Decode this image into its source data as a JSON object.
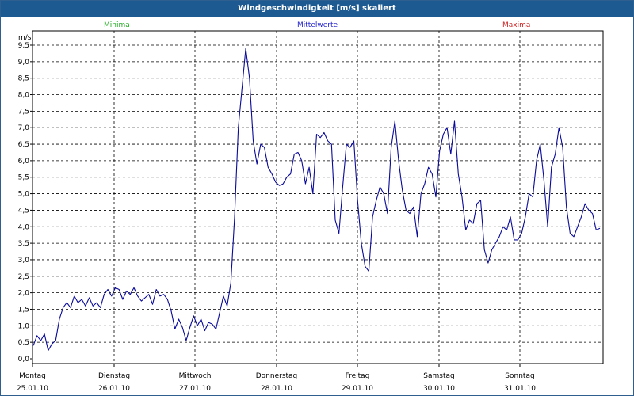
{
  "window": {
    "title": "Windgeschwindigkeit [m/s] skaliert"
  },
  "legend": [
    {
      "label": "Minima",
      "color": "#22aa22"
    },
    {
      "label": "Mittelwerte",
      "color": "#2222cc"
    },
    {
      "label": "Maxima",
      "color": "#cc2222"
    }
  ],
  "colors": {
    "series": "#0a0a9a",
    "grid": "#000000",
    "titlebar": "#1d5a91"
  },
  "chart_data": {
    "type": "line",
    "title": "Windgeschwindigkeit [m/s] skaliert",
    "ylabel": "m/s",
    "ylim": [
      0,
      9.5
    ],
    "yticks": [
      "0,0",
      "0,5",
      "1,0",
      "1,5",
      "2,0",
      "2,5",
      "3,0",
      "3,5",
      "4,0",
      "4,5",
      "5,0",
      "5,5",
      "6,0",
      "6,5",
      "7,0",
      "7,5",
      "8,0",
      "8,5",
      "9,0",
      "9,5"
    ],
    "xticks": [
      {
        "day": "Montag",
        "date": "25.01.10"
      },
      {
        "day": "Dienstag",
        "date": "26.01.10"
      },
      {
        "day": "Mittwoch",
        "date": "27.01.10"
      },
      {
        "day": "Donnerstag",
        "date": "28.01.10"
      },
      {
        "day": "Freitag",
        "date": "29.01.10"
      },
      {
        "day": "Samstag",
        "date": "30.01.10"
      },
      {
        "day": "Sonntag",
        "date": "31.01.10"
      }
    ],
    "grid": true,
    "series": [
      {
        "name": "Mittelwerte",
        "color": "#0a0a9a",
        "values": [
          0.4,
          0.7,
          0.55,
          0.75,
          0.25,
          0.45,
          0.55,
          1.2,
          1.55,
          1.7,
          1.55,
          1.9,
          1.7,
          1.8,
          1.6,
          1.85,
          1.6,
          1.7,
          1.55,
          1.95,
          2.1,
          1.9,
          2.15,
          2.1,
          1.8,
          2.05,
          1.95,
          2.15,
          1.9,
          1.75,
          1.85,
          1.95,
          1.65,
          2.1,
          1.9,
          1.95,
          1.8,
          1.45,
          0.9,
          1.2,
          0.95,
          0.55,
          0.95,
          1.3,
          1.0,
          1.2,
          0.85,
          1.1,
          1.05,
          0.9,
          1.4,
          1.9,
          1.6,
          2.3,
          4.3,
          7.0,
          8.2,
          9.4,
          8.5,
          6.6,
          5.9,
          6.5,
          6.4,
          5.8,
          5.6,
          5.35,
          5.25,
          5.3,
          5.5,
          5.6,
          6.2,
          6.25,
          6.0,
          5.3,
          5.8,
          5.0,
          6.8,
          6.7,
          6.85,
          6.6,
          6.5,
          4.2,
          3.8,
          5.2,
          6.5,
          6.4,
          6.6,
          4.8,
          3.5,
          2.8,
          2.65,
          4.3,
          4.8,
          5.2,
          5.0,
          4.4,
          6.4,
          7.2,
          6.0,
          5.1,
          4.5,
          4.4,
          4.6,
          3.7,
          5.0,
          5.3,
          5.8,
          5.6,
          4.9,
          6.3,
          6.8,
          7.0,
          6.2,
          7.2,
          5.6,
          4.9,
          3.9,
          4.2,
          4.1,
          4.7,
          4.8,
          3.3,
          2.9,
          3.3,
          3.5,
          3.7,
          4.0,
          3.9,
          4.3,
          3.6,
          3.6,
          3.8,
          4.3,
          5.0,
          4.9,
          6.0,
          6.5,
          5.4,
          4.0,
          5.8,
          6.2,
          7.0,
          6.4,
          4.6,
          3.8,
          3.7,
          4.0,
          4.3,
          4.7,
          4.5,
          4.4,
          3.9,
          3.95
        ]
      }
    ]
  }
}
